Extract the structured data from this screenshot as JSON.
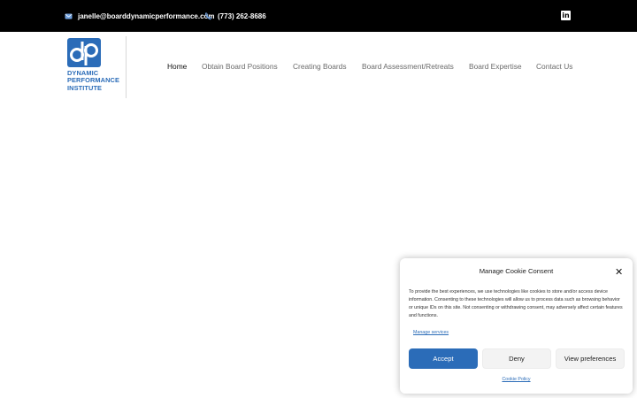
{
  "topbar": {
    "email": "janelle@boarddynamicperformance.com",
    "phone": "(773) 262-8686",
    "linkedin_icon": "in"
  },
  "logo": {
    "mark": "dp",
    "line1": "DYNAMIC",
    "line2": "PERFORMANCE",
    "line3": "INSTITUTE"
  },
  "nav": {
    "items": [
      {
        "label": "Home"
      },
      {
        "label": "Obtain Board Positions"
      },
      {
        "label": "Creating Boards"
      },
      {
        "label": "Board Assessment/Retreats"
      },
      {
        "label": "Board Expertise"
      },
      {
        "label": "Contact Us"
      }
    ]
  },
  "cookie": {
    "title": "Manage Cookie Consent",
    "close": "✕",
    "body": "To provide the best experiences, we use technologies like cookies to store and/or access device information. Consenting to these technologies will allow us to process data such as browsing behavior or unique IDs on this site. Not consenting or withdrawing consent, may adversely affect certain features and functions.",
    "manage_services": "Manage services",
    "accept": "Accept",
    "deny": "Deny",
    "view_preferences": "View preferences",
    "policy": "Cookie Policy"
  },
  "colors": {
    "brand": "#2b6cb8",
    "topbar": "#000000"
  }
}
